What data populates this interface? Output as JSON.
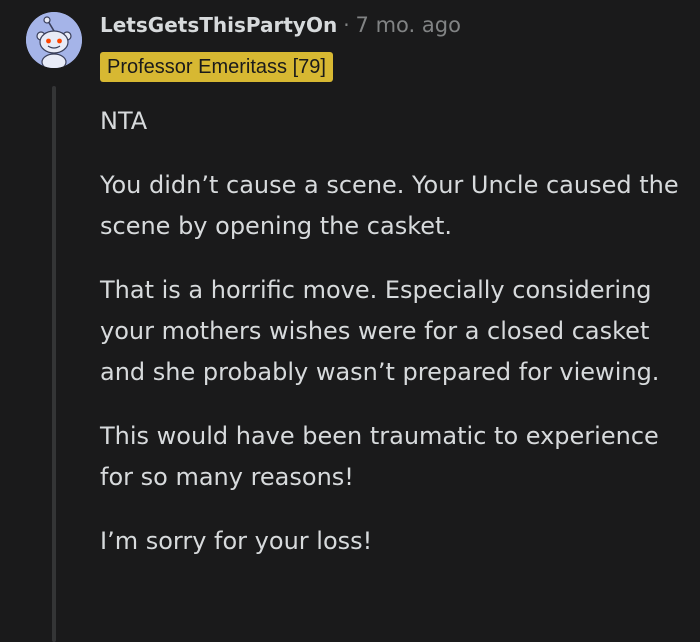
{
  "comment": {
    "author": "LetsGetsThisPartyOn",
    "separator": "·",
    "timestamp": "7 mo. ago",
    "flair": "Professor Emeritass [79]",
    "avatar_icon": "snoo-avatar-icon",
    "colors": {
      "background": "#1a1a1b",
      "text": "#d7dadc",
      "meta": "#818384",
      "flair_bg": "#d7b832",
      "avatar_bg": "#a5b4e8"
    },
    "paragraphs": [
      "NTA",
      "You didn’t cause a scene. Your Uncle caused the scene by opening the casket.",
      "That is a horrific move. Especially considering your mothers wishes were for a closed casket and she probably wasn’t prepared for viewing.",
      "This would have been traumatic to experience for so many reasons!",
      "I’m sorry for your loss!"
    ]
  }
}
